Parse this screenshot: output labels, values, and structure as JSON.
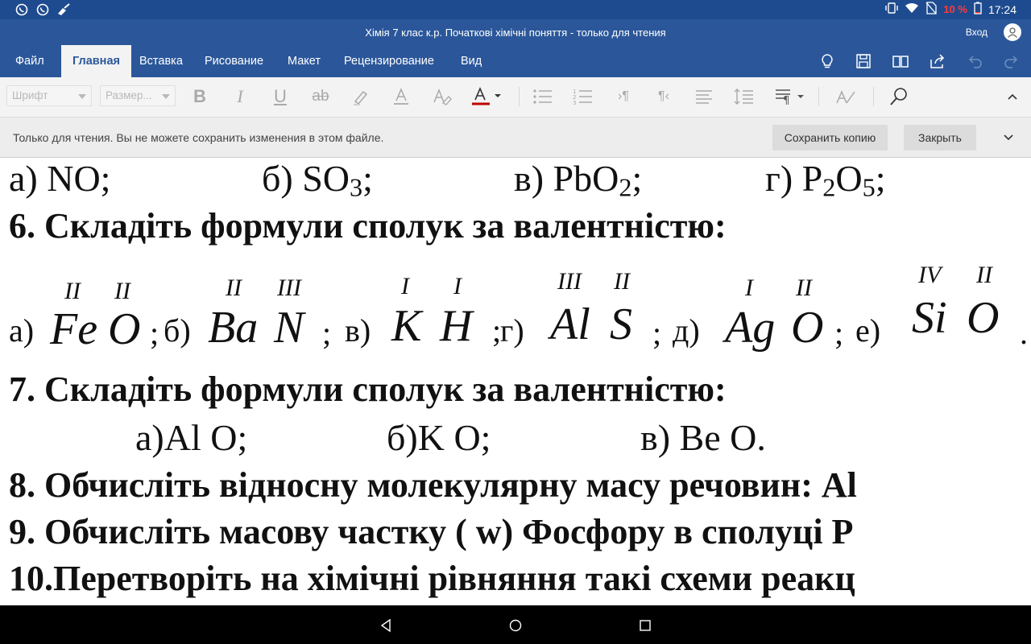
{
  "status_bar": {
    "battery_percent": "10 %",
    "time": "17:24",
    "left_icons": [
      "viber-icon",
      "viber-icon",
      "cleaner-icon"
    ],
    "right_icons": [
      "vibrate-icon",
      "wifi-icon",
      "no-sim-icon",
      "battery-icon"
    ]
  },
  "window": {
    "title": "Хімія 7 клас к.р. Початкові хімічні поняття - только для чтения",
    "sign_in": "Вход"
  },
  "ribbon": {
    "tabs": [
      {
        "label": "Файл"
      },
      {
        "label": "Главная",
        "active": true
      },
      {
        "label": "Вставка"
      },
      {
        "label": "Рисование"
      },
      {
        "label": "Макет"
      },
      {
        "label": "Рецензирование"
      },
      {
        "label": "Вид"
      }
    ],
    "right_icons": [
      "lightbulb-icon",
      "save-icon",
      "reading-view-icon",
      "share-icon",
      "undo-icon",
      "redo-icon"
    ]
  },
  "toolbar": {
    "font_placeholder": "Шрифт",
    "size_placeholder": "Размер...",
    "buttons": [
      "bold-icon",
      "italic-icon",
      "underline-icon",
      "strikethrough-icon",
      "highlight-icon",
      "font-color-icon",
      "clear-format-icon",
      "font-color-dropdown-icon",
      "bullets-icon",
      "numbering-icon",
      "decrease-indent-icon",
      "increase-indent-icon",
      "align-icon",
      "line-spacing-icon",
      "paragraph-icon",
      "styles-icon",
      "find-icon",
      "collapse-ribbon-icon"
    ]
  },
  "message_bar": {
    "text": "Только для чтения. Вы не можете сохранить изменения в этом файле.",
    "save_copy": "Сохранить копию",
    "close": "Закрыть"
  },
  "document": {
    "line1": {
      "a": "а) NO;",
      "b_prefix": "б) SO",
      "b_sub": "3",
      "b_suffix": ";",
      "c_prefix": "в) PbO",
      "c_sub": "2",
      "c_suffix": ";",
      "d_prefix": "г) P",
      "d_sub1": "2",
      "d_mid": "O",
      "d_sub2": "5",
      "d_suffix": ";"
    },
    "task6": "6. Складіть формули сполук за валентністю:",
    "task6_items": [
      {
        "label": "а)",
        "el1": "Fe",
        "v1": "II",
        "el2": "O",
        "v2": "II",
        "sep": ";"
      },
      {
        "label": "б)",
        "el1": "Ba",
        "v1": "II",
        "el2": "N",
        "v2": "III",
        "sep": ";"
      },
      {
        "label": "в)",
        "el1": "K",
        "v1": "I",
        "el2": "H",
        "v2": "I",
        "sep": ";"
      },
      {
        "label": "г)",
        "el1": "Al",
        "v1": "III",
        "el2": "S",
        "v2": "II",
        "sep": ";"
      },
      {
        "label": "д)",
        "el1": "Ag",
        "v1": "I",
        "el2": "O",
        "v2": "II",
        "sep": ";"
      },
      {
        "label": "е)",
        "el1": "Si",
        "v1": "IV",
        "el2": "O",
        "v2": "II",
        "sep": "."
      }
    ],
    "task7": "7. Складіть формули сполук за валентністю:",
    "task7_items": [
      "а)Al O;",
      "б)K O;",
      "в) Be O."
    ],
    "task8": "8. Обчисліть відносну молекулярну масу речовин: Al",
    "task9": "9. Обчисліть масову частку ( w) Фосфору в сполуці P",
    "task10": "10.Перетворіть на хімічні рівняння такі схеми реакц"
  },
  "nav_bar": [
    "back-icon",
    "home-icon",
    "recents-icon"
  ]
}
